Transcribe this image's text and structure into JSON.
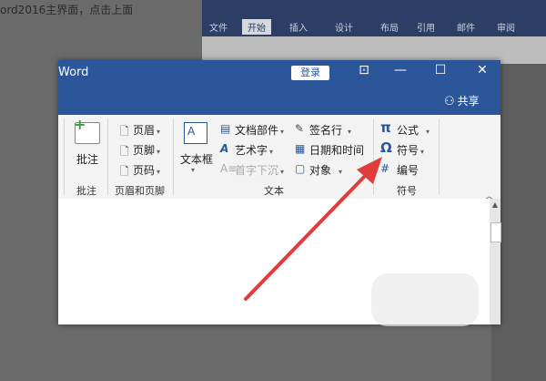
{
  "background": {
    "caption": "ord2016主界面，点击上面",
    "tabs": [
      "文件",
      "开始",
      "插入",
      "设计",
      "布局",
      "引用",
      "邮件",
      "审阅"
    ],
    "active_tab": "开始"
  },
  "window": {
    "title": "Word",
    "login_label": "登录",
    "share_label": "共享"
  },
  "ribbon": {
    "groups": {
      "comment": {
        "button": "批注",
        "label": "批注"
      },
      "header_footer": {
        "items": [
          "页眉",
          "页脚",
          "页码"
        ],
        "label": "页眉和页脚"
      },
      "text": {
        "textbox": "文本框",
        "col1": [
          "文档部件",
          "艺术字",
          "首字下沉"
        ],
        "col2": [
          "签名行",
          "日期和时间",
          "对象"
        ],
        "label": "文本"
      },
      "symbols": {
        "items": [
          "公式",
          "符号",
          "编号"
        ],
        "label": "符号"
      }
    }
  },
  "colors": {
    "title_bar": "#2b579a",
    "arrow": "#e23b3b"
  }
}
